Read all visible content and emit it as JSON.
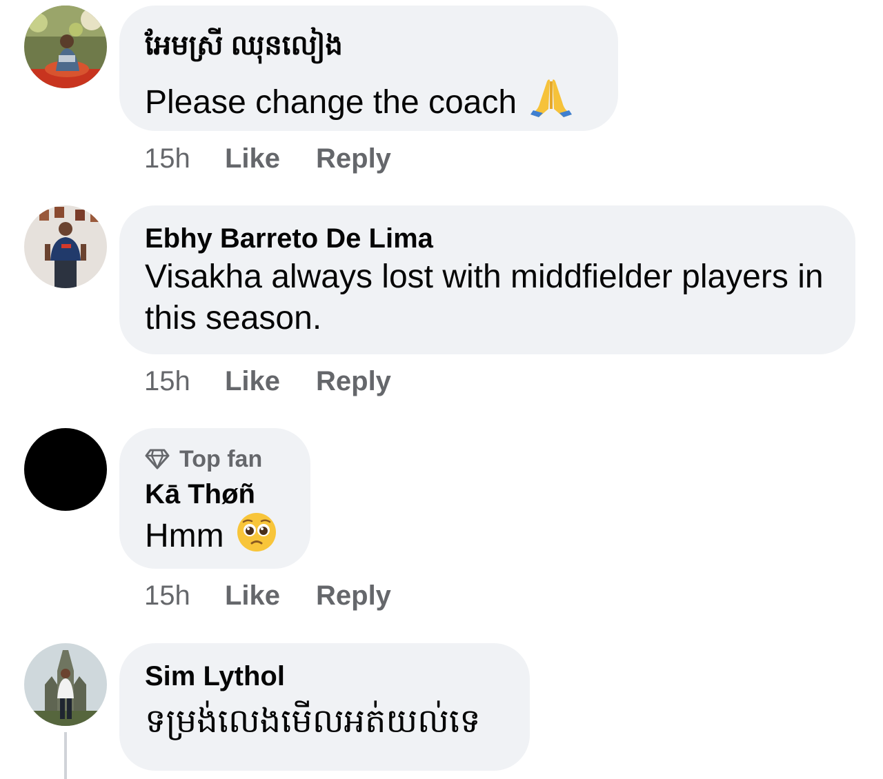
{
  "comments": [
    {
      "author": "អែមស្រី ឈុនលៀង",
      "text": "Please change the coach",
      "emoji": "folded-hands-emoji",
      "time": "15h",
      "like_label": "Like",
      "reply_label": "Reply"
    },
    {
      "author": "Ebhy Barreto De Lima",
      "text": "Visakha always lost with middfielder players in this season.",
      "time": "15h",
      "like_label": "Like",
      "reply_label": "Reply"
    },
    {
      "badge": "Top fan",
      "badge_icon": "diamond-icon",
      "author": "Kā Thøñ",
      "text": "Hmm",
      "emoji": "pleading-face-emoji",
      "time": "15h",
      "like_label": "Like",
      "reply_label": "Reply"
    },
    {
      "author": "Sim Lythol",
      "text": "ទម្រង់លេងមើលអត់យល់ទេ"
    }
  ],
  "colors": {
    "bubble": "#f0f2f5",
    "secondary_text": "#65676b",
    "primary_text": "#050505"
  }
}
